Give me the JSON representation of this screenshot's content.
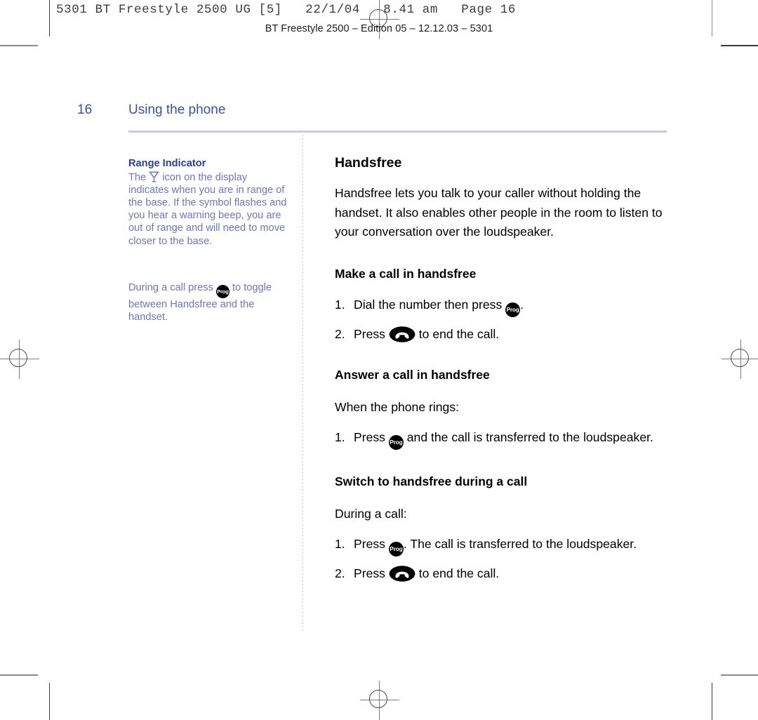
{
  "print_marks": {
    "slug": "5301 BT Freestyle 2500 UG [5]   22/1/04   8.41 am   Page 16",
    "edition_line": "BT Freestyle 2500 – Edition 05 – 12.12.03 – 5301"
  },
  "page_header": {
    "folio": "16",
    "chapter_title": "Using the phone"
  },
  "sidebar": {
    "notes": [
      {
        "title": "Range Indicator",
        "text_before_icon": "The ",
        "icon": "antenna-icon",
        "text_after_icon": " icon on the display indicates when you are in range of the base. If the symbol flashes and you hear a warning beep, you are out of range and will need to move closer to the base."
      },
      {
        "title": "",
        "text_before_icon": "During a call press ",
        "icon": "prog-key-icon",
        "text_after_icon": " to toggle between Handsfree and the handset."
      }
    ]
  },
  "main": {
    "heading": "Handsfree",
    "intro": "Handsfree lets you talk to your caller without holding the handset. It also enables other people in the room to listen to your conversation over the loudspeaker.",
    "sections": [
      {
        "heading": "Make a call in handsfree",
        "lead": "",
        "steps": [
          {
            "num": "1.",
            "before": "Dial the number then press ",
            "icon": "prog-key-icon",
            "after": "."
          },
          {
            "num": "2.",
            "before": "Press ",
            "icon": "end-call-key-icon",
            "after": " to end the call."
          }
        ]
      },
      {
        "heading": "Answer a call in handsfree",
        "lead": "When the phone rings:",
        "steps": [
          {
            "num": "1.",
            "before": "Press ",
            "icon": "prog-key-icon",
            "after": " and the call is transferred to the loudspeaker."
          }
        ]
      },
      {
        "heading": "Switch to handsfree during a call",
        "lead": "During a call:",
        "steps": [
          {
            "num": "1.",
            "before": "Press ",
            "icon": "prog-key-icon",
            "after": ". The call is transferred to the loudspeaker."
          },
          {
            "num": "2.",
            "before": "Press ",
            "icon": "end-call-key-icon",
            "after": " to end the call."
          }
        ]
      }
    ]
  },
  "icons": {
    "prog_label": "Prog"
  },
  "colors": {
    "accent_blue": "#3f4fa8",
    "note_body": "#6f74c0",
    "note_title": "#2b3f9e",
    "rule": "#c9cbe8",
    "text": "#000000"
  }
}
